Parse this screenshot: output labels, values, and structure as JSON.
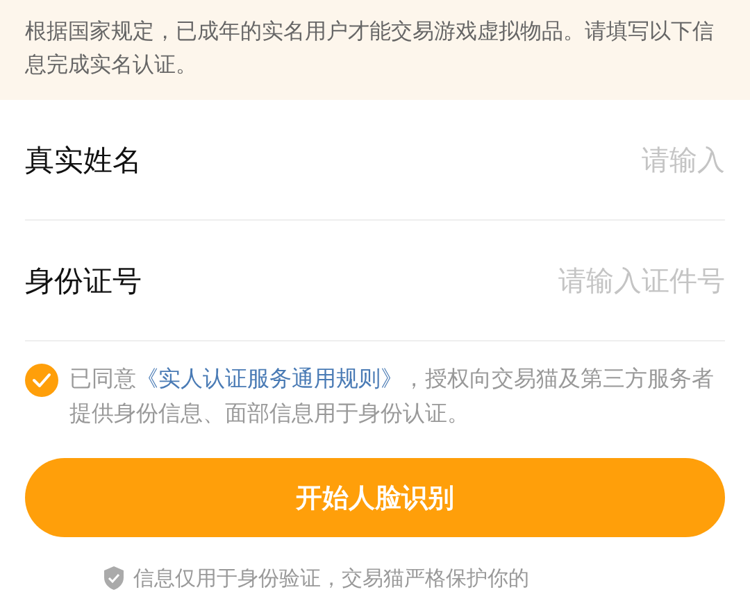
{
  "notice": "根据国家规定，已成年的实名用户才能交易游戏虚拟物品。请填写以下信息完成实名认证。",
  "fields": [
    {
      "label": "真实姓名",
      "placeholder": "请输入"
    },
    {
      "label": "身份证号",
      "placeholder": "请输入证件号"
    }
  ],
  "agreement": {
    "checked": true,
    "prefix": "已同意",
    "link": "《实人认证服务通用规则》",
    "suffix": "，授权向交易猫及第三方服务者提供身份信息、面部信息用于身份认证。"
  },
  "button": "开始人脸识别",
  "footer": "信息仅用于身份验证，交易猫严格保护你的"
}
